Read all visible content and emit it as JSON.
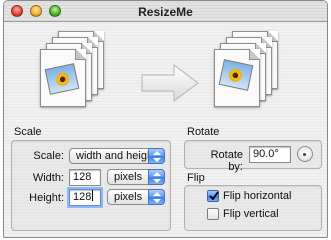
{
  "window": {
    "title": "ResizeMe"
  },
  "scale": {
    "group_label": "Scale",
    "scale_label": "Scale:",
    "scale_mode": "width and height",
    "width_label": "Width:",
    "width_value": "128",
    "width_unit": "pixels",
    "height_label": "Height:",
    "height_value": "128",
    "height_unit": "pixels"
  },
  "rotate": {
    "group_label": "Rotate",
    "rotate_label": "Rotate by:",
    "rotate_value": "90.0°"
  },
  "flip": {
    "group_label": "Flip",
    "horizontal_label": "Flip horizontal",
    "horizontal_checked": true,
    "vertical_label": "Flip vertical",
    "vertical_checked": false
  },
  "colors": {
    "accent": "#3a7de6"
  }
}
